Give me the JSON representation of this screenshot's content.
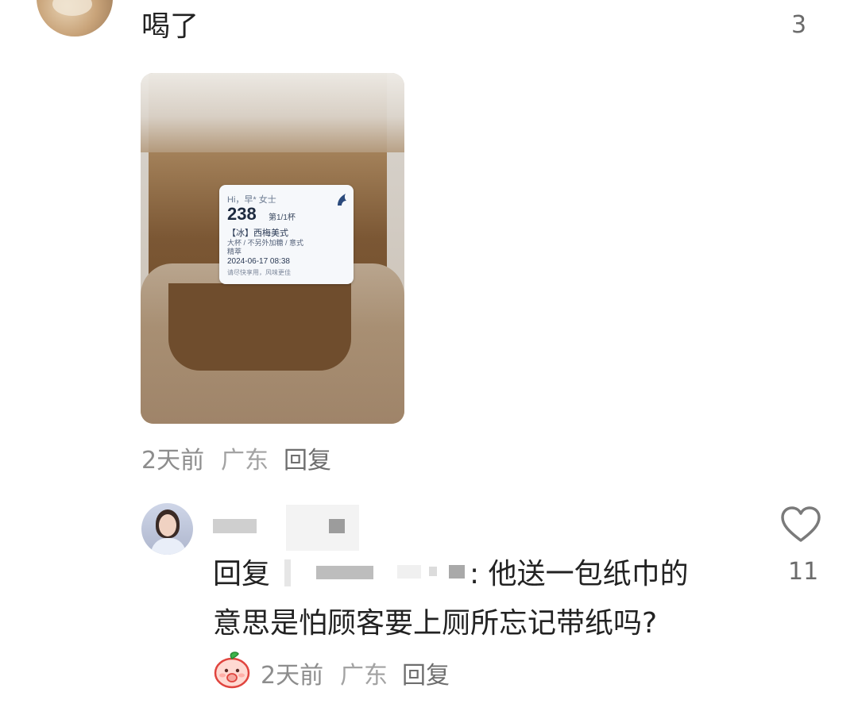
{
  "comment_top": {
    "text": "喝了",
    "likes": "3",
    "photo": {
      "label": {
        "greeting": "Hi，早* 女士",
        "number": "238",
        "cup": "第1/1杯",
        "name": "【冰】西梅美式",
        "spec": "大杯 / 不另外加糖 / 意式",
        "spec2": "精萃",
        "date": "2024-06-17 08:38",
        "footer": "请尽快享用，风味更佳"
      }
    },
    "meta": {
      "time": "2天前",
      "location": "广东",
      "reply": "回复"
    }
  },
  "reply_comment": {
    "prefix": "回复",
    "text_line1": ": 他送一包纸巾的",
    "text_line2": "意思是怕顾客要上厕所忘记带纸吗?",
    "likes": "11",
    "meta": {
      "time": "2天前",
      "location": "广东",
      "reply": "回复"
    }
  },
  "icons": {
    "heart": "heart-icon",
    "emoji": "peach-emoji-icon"
  },
  "colors": {
    "text": "#222222",
    "meta": "#8d8d8d",
    "label_text": "#2b3a55"
  }
}
